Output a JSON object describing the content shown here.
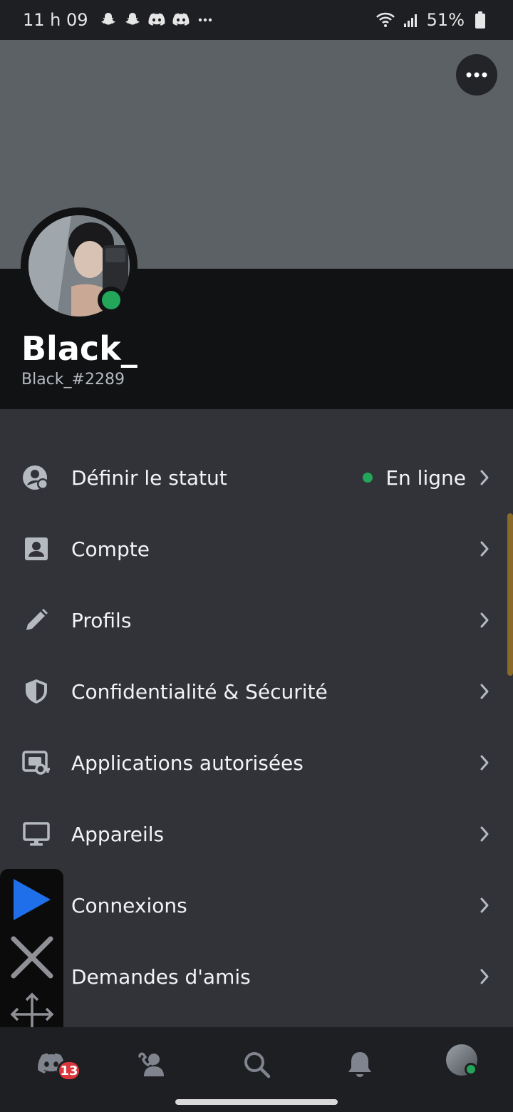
{
  "status_bar": {
    "time": "11 h 09",
    "notif_icons": [
      "snapchat-icon",
      "snapchat-icon",
      "discord-icon",
      "discord-icon",
      "more-notifications-icon"
    ],
    "battery": "51%"
  },
  "profile": {
    "display_name": "Black_",
    "tag": "Black_#2289",
    "status_color": "#23a55a"
  },
  "menu": [
    {
      "label": "Définir le statut",
      "icon": "status-icon",
      "value": "En ligne"
    },
    {
      "label": "Compte",
      "icon": "account-icon"
    },
    {
      "label": "Profils",
      "icon": "pencil-icon"
    },
    {
      "label": "Confidentialité & Sécurité",
      "icon": "shield-icon"
    },
    {
      "label": "Applications autorisées",
      "icon": "authorized-apps-icon"
    },
    {
      "label": "Appareils",
      "icon": "monitor-icon"
    },
    {
      "label": "Connexions",
      "icon": "connections-icon"
    },
    {
      "label": "Demandes d'amis",
      "icon": "friend-requests-icon"
    }
  ],
  "bottom_nav": {
    "items": [
      "discord-home-icon",
      "friends-icon",
      "search-icon",
      "bell-icon",
      "profile-avatar"
    ],
    "badge": "13"
  },
  "colors": {
    "background": "#313338",
    "banner": "#5c6166",
    "header": "#111214",
    "online": "#23a55a",
    "badge": "#da373c",
    "overlay_play": "#1f6feb"
  }
}
